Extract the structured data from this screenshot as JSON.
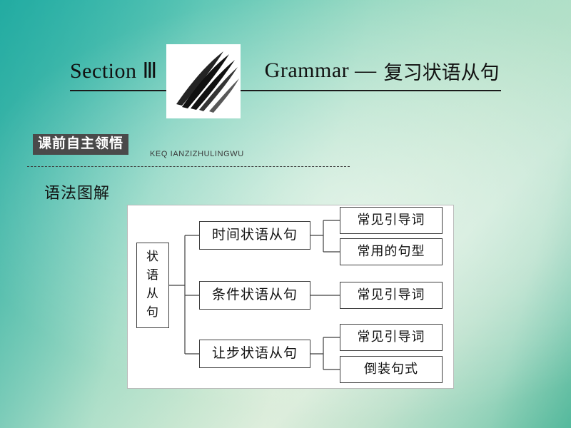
{
  "slide": {
    "title": {
      "section_label": "Section Ⅲ",
      "subject": "Grammar —",
      "topic_cn": "复习状语从句"
    },
    "banner": {
      "tag": "课前自主领悟",
      "pinyin": "KEQ IANZIZHULINGWU"
    },
    "section_heading": "语法图解",
    "diagram": {
      "root": [
        "状",
        "语",
        "从",
        "句"
      ],
      "branches": [
        {
          "label": "时间状语从句",
          "children": [
            "常见引导词",
            "常用的句型"
          ]
        },
        {
          "label": "条件状语从句",
          "children": [
            "常见引导词"
          ]
        },
        {
          "label": "让步状语从句",
          "children": [
            "常见引导词",
            "倒装句式"
          ]
        }
      ]
    },
    "colors": {
      "background_start": "#2fb9b0",
      "background_end": "#79c5aa",
      "banner_tag_bg": "#4a4a4a",
      "node_border": "#3f3f3f"
    }
  }
}
